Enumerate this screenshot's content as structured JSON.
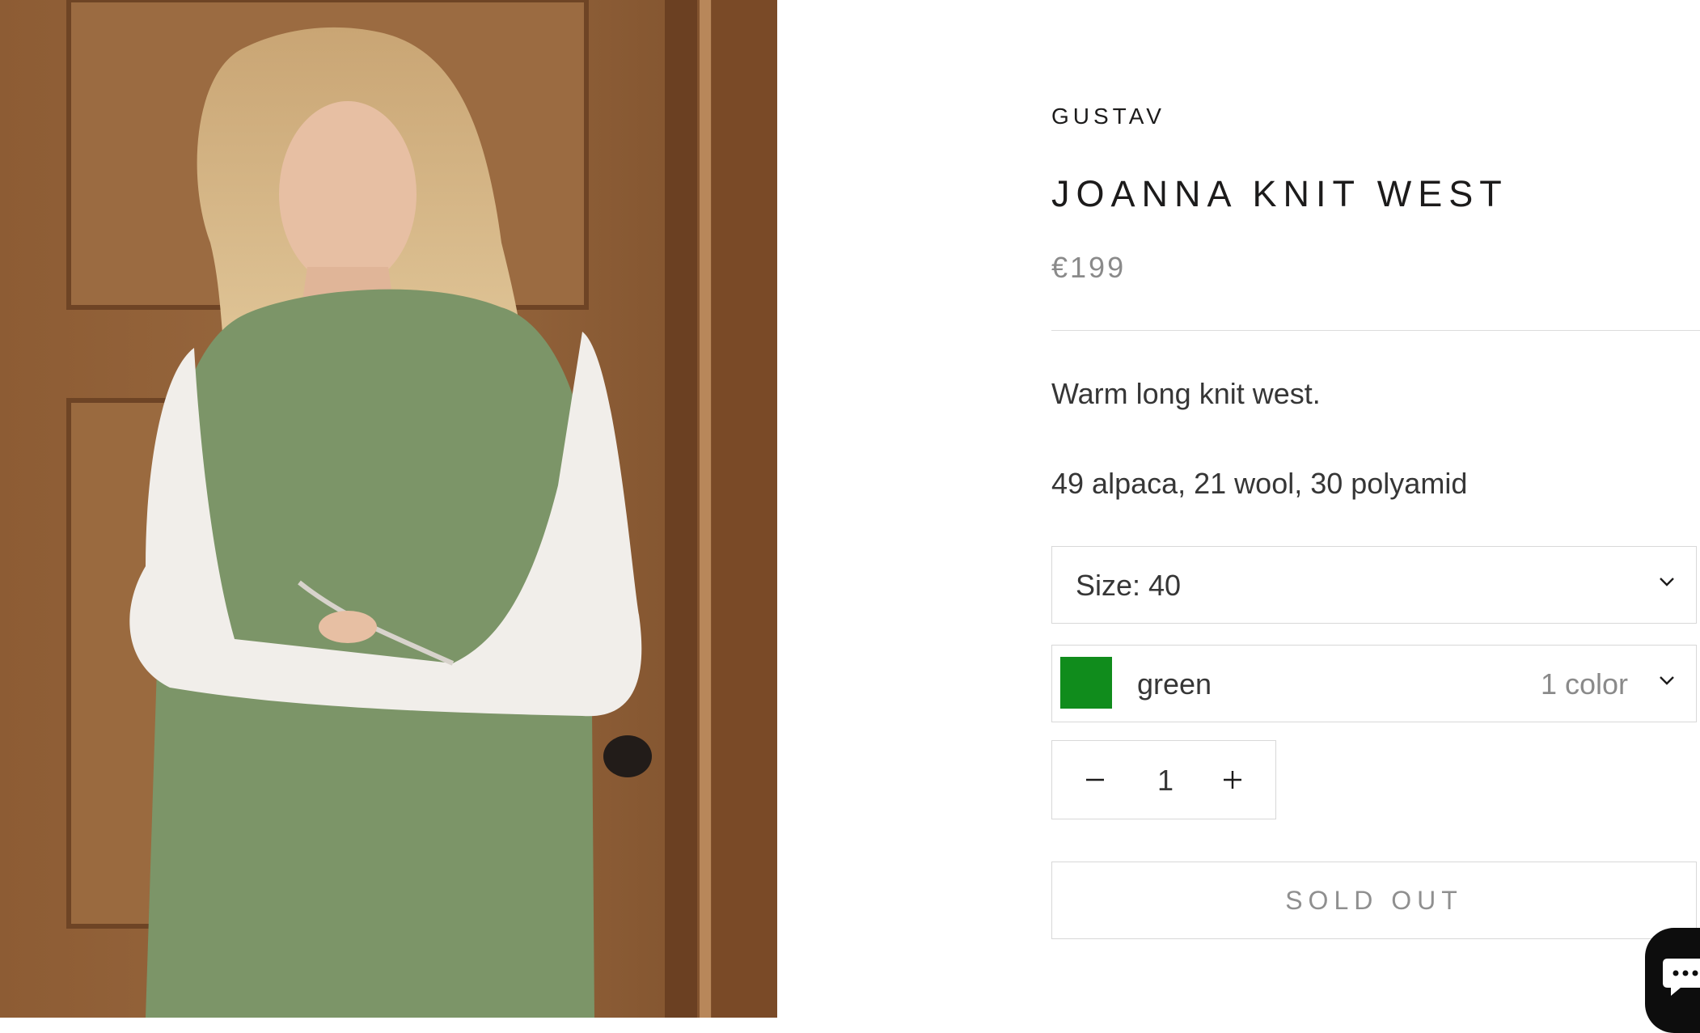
{
  "product": {
    "vendor": "GUSTAV",
    "title": "JOANNA KNIT WEST",
    "price": "€199",
    "description": "Warm long knit west.",
    "material": "49 alpaca, 21 wool, 30 polyamid"
  },
  "size_select": {
    "label": "Size: 40"
  },
  "color_select": {
    "label": "green",
    "count": "1 color",
    "swatch_color": "#108c1c"
  },
  "quantity": {
    "value": "1"
  },
  "buttons": {
    "sold_out": "SOLD OUT"
  },
  "icons": {
    "size_chevron": "chevron-down-icon",
    "color_chevron": "chevron-down-icon",
    "minus": "minus-icon",
    "plus": "plus-icon",
    "chat": "chat-icon"
  }
}
